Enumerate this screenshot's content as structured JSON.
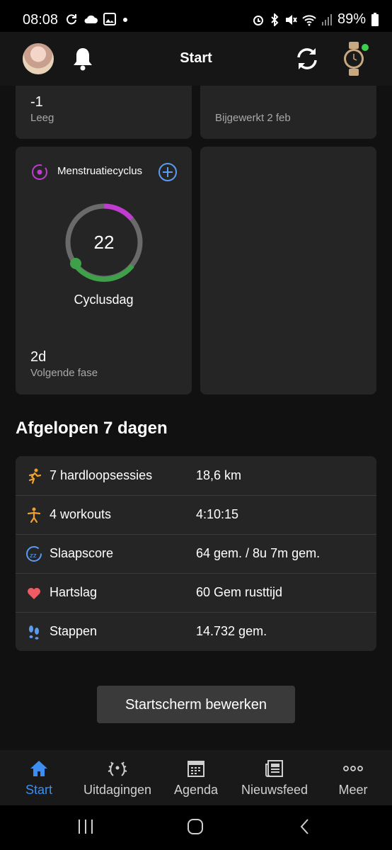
{
  "status_bar": {
    "time": "08:08",
    "battery": "89%"
  },
  "header": {
    "title": "Start"
  },
  "cards": {
    "top_left": {
      "value": "-1",
      "label": "Leeg"
    },
    "top_right": {
      "label": "Bijgewerkt 2 feb"
    },
    "cycle": {
      "title": "Menstruatiecyclus",
      "day": "22",
      "day_label": "Cyclusdag",
      "next_value": "2d",
      "next_label": "Volgende fase",
      "accent": "#c13bd1",
      "green": "#3fa04a"
    }
  },
  "section": {
    "title": "Afgelopen 7 dagen"
  },
  "stats": [
    {
      "icon": "running-icon",
      "label": "7 hardloopsessies",
      "value": "18,6 km"
    },
    {
      "icon": "workout-icon",
      "label": "4 workouts",
      "value": "4:10:15"
    },
    {
      "icon": "sleep-icon",
      "label": "Slaapscore",
      "value": "64 gem. / 8u 7m gem."
    },
    {
      "icon": "heart-icon",
      "label": "Hartslag",
      "value": "60 Gem rusttijd"
    },
    {
      "icon": "steps-icon",
      "label": "Stappen",
      "value": "14.732 gem."
    }
  ],
  "edit_button": "Startscherm bewerken",
  "bottom_nav": [
    {
      "label": "Start",
      "icon": "home-icon",
      "active": true
    },
    {
      "label": "Uitdagingen",
      "icon": "laurel-icon"
    },
    {
      "label": "Agenda",
      "icon": "calendar-icon"
    },
    {
      "label": "Nieuwsfeed",
      "icon": "newsfeed-icon"
    },
    {
      "label": "Meer",
      "icon": "more-icon"
    }
  ]
}
